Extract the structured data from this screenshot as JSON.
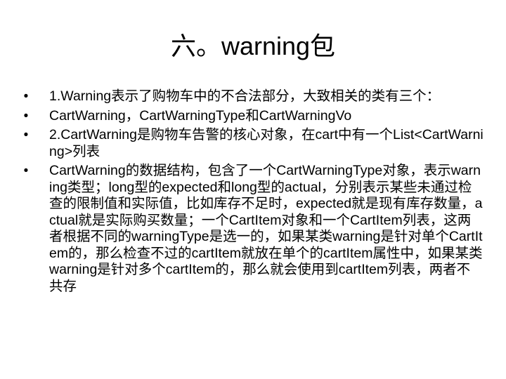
{
  "slide": {
    "title": "六。warning包",
    "bullet_symbol": "•",
    "bullets": [
      "1.Warning表示了购物车中的不合法部分，大致相关的类有三个：",
      "CartWarning，CartWarningType和CartWarningVo",
      "2.CartWarning是购物车告警的核心对象，在cart中有一个List<CartWarning>列表",
      "CartWarning的数据结构，包含了一个CartWarningType对象，表示warning类型；long型的expected和long型的actual，分别表示某些未通过检查的限制值和实际值，比如库存不足时，expected就是现有库存数量，actual就是实际购买数量；一个CartItem对象和一个CartItem列表，这两者根据不同的warningType是选一的，如果某类warning是针对单个CartItem的，那么检查不过的cartItem就放在单个的cartItem属性中，如果某类warning是针对多个cartItem的，那么就会使用到cartItem列表，两者不共存"
    ]
  }
}
